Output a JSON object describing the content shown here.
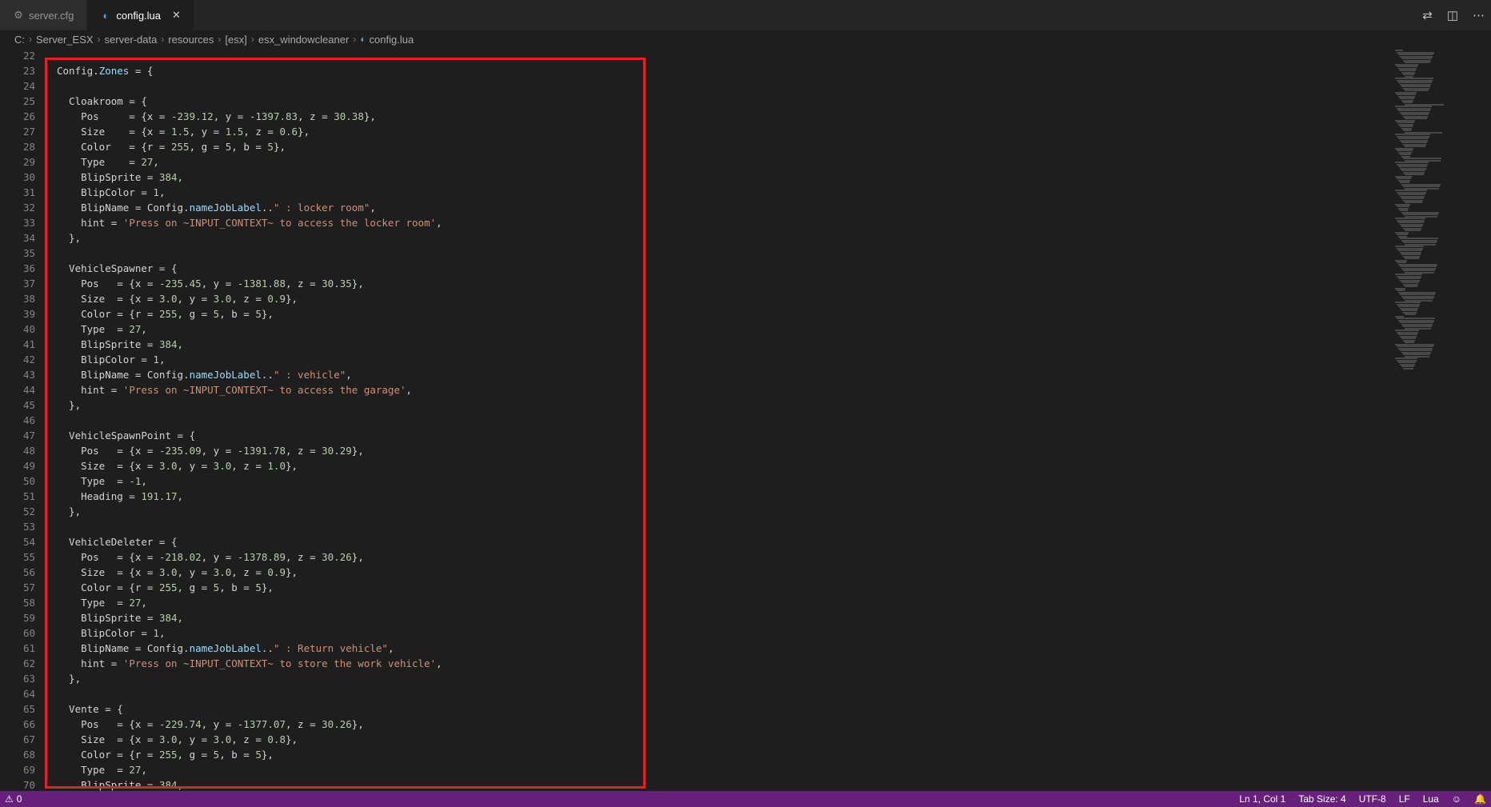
{
  "tabs": [
    {
      "label": "server.cfg",
      "icon": "gear-icon",
      "active": false
    },
    {
      "label": "config.lua",
      "icon": "lua-file-icon",
      "active": true
    }
  ],
  "breadcrumb": [
    "C:",
    "Server_ESX",
    "server-data",
    "resources",
    "[esx]",
    "esx_windowcleaner",
    "config.lua"
  ],
  "editor": {
    "first_line": 22,
    "lines": [
      "",
      "Config.Zones = {",
      "",
      "  Cloakroom = {",
      "    Pos     = {x = -239.12, y = -1397.83, z = 30.38},",
      "    Size    = {x = 1.5, y = 1.5, z = 0.6},",
      "    Color   = {r = 255, g = 5, b = 5},",
      "    Type    = 27,",
      "    BlipSprite = 384,",
      "    BlipColor = 1,",
      "    BlipName = Config.nameJobLabel..\" : locker room\",",
      "    hint = 'Press on ~INPUT_CONTEXT~ to access the locker room',",
      "  },",
      "",
      "  VehicleSpawner = {",
      "    Pos   = {x = -235.45, y = -1381.88, z = 30.35},",
      "    Size  = {x = 3.0, y = 3.0, z = 0.9},",
      "    Color = {r = 255, g = 5, b = 5},",
      "    Type  = 27,",
      "    BlipSprite = 384,",
      "    BlipColor = 1,",
      "    BlipName = Config.nameJobLabel..\" : vehicle\",",
      "    hint = 'Press on ~INPUT_CONTEXT~ to access the garage',",
      "  },",
      "",
      "  VehicleSpawnPoint = {",
      "    Pos   = {x = -235.09, y = -1391.78, z = 30.29},",
      "    Size  = {x = 3.0, y = 3.0, z = 1.0},",
      "    Type  = -1,",
      "    Heading = 191.17,",
      "  },",
      "",
      "  VehicleDeleter = {",
      "    Pos   = {x = -218.02, y = -1378.89, z = 30.26},",
      "    Size  = {x = 3.0, y = 3.0, z = 0.9},",
      "    Color = {r = 255, g = 5, b = 5},",
      "    Type  = 27,",
      "    BlipSprite = 384,",
      "    BlipColor = 1,",
      "    BlipName = Config.nameJobLabel..\" : Return vehicle\",",
      "    hint = 'Press on ~INPUT_CONTEXT~ to store the work vehicle',",
      "  },",
      "",
      "  Vente = {",
      "    Pos   = {x = -229.74, y = -1377.07, z = 30.26},",
      "    Size  = {x = 3.0, y = 3.0, z = 0.8},",
      "    Color = {r = 255, g = 5, b = 5},",
      "    Type  = 27,",
      "    BlipSprite = 384,"
    ]
  },
  "status": {
    "problems": "0",
    "position": "Ln 1, Col 1",
    "tab_size": "Tab Size: 4",
    "encoding": "UTF-8",
    "eol": "LF",
    "language": "Lua"
  },
  "colors": {
    "highlight_border": "#e3212b",
    "statusbar": "#68217a"
  }
}
